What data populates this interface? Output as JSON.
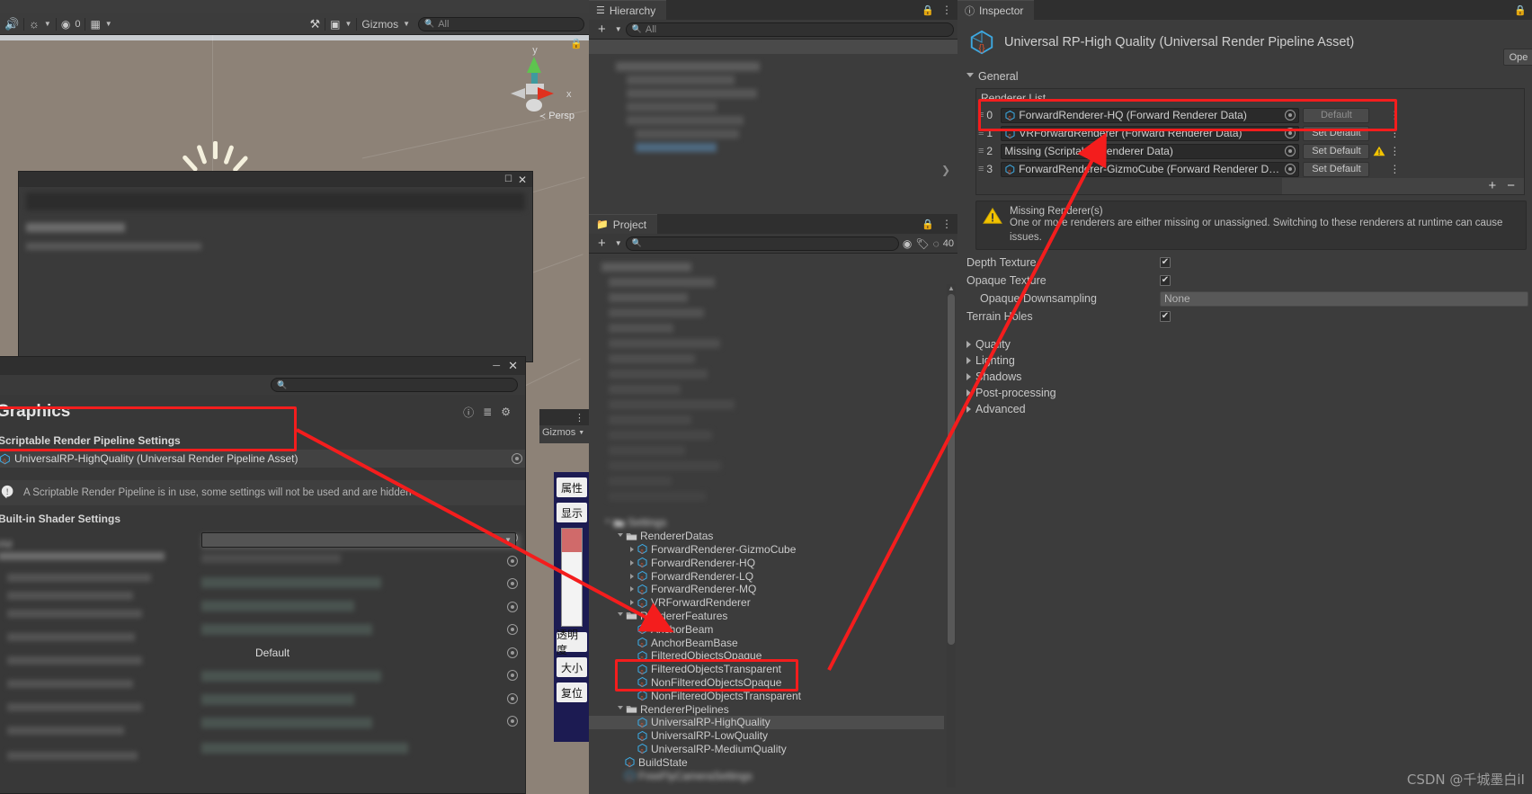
{
  "scene": {
    "toolbar": {
      "audio_icon": "audio-mute-icon",
      "lighting_icon": "lighting-icon",
      "fx_count": "0",
      "grid_icon": "grid-snap-icon",
      "tools_icon": "scene-tools-icon",
      "camera_icon": "scene-camera-icon",
      "gizmos_label": "Gizmos",
      "search_placeholder": "All"
    },
    "gizmo": {
      "axis_y": "y",
      "axis_x": "x",
      "persp_label": "Persp"
    }
  },
  "hierarchy": {
    "tab_label": "Hierarchy",
    "add_label": "+",
    "search_placeholder": "All",
    "lock_icon": "lock-icon",
    "menu_icon": "kebab-menu-icon"
  },
  "project": {
    "tab_label": "Project",
    "add_label": "+",
    "search_placeholder": "",
    "badge_count": "40",
    "lock_icon": "lock-icon",
    "menu_icon": "kebab-menu-icon",
    "tree": [
      {
        "label": "Settings",
        "indent": 1,
        "type": "folder",
        "state": "open",
        "blur": true
      },
      {
        "label": "RendererDatas",
        "indent": 2,
        "type": "folder",
        "state": "open"
      },
      {
        "label": "ForwardRenderer-GizmoCube",
        "indent": 3,
        "type": "asset",
        "state": "closed"
      },
      {
        "label": "ForwardRenderer-HQ",
        "indent": 3,
        "type": "asset",
        "state": "closed"
      },
      {
        "label": "ForwardRenderer-LQ",
        "indent": 3,
        "type": "asset",
        "state": "closed"
      },
      {
        "label": "ForwardRenderer-MQ",
        "indent": 3,
        "type": "asset",
        "state": "closed"
      },
      {
        "label": "VRForwardRenderer",
        "indent": 3,
        "type": "asset",
        "state": "closed"
      },
      {
        "label": "RendererFeatures",
        "indent": 2,
        "type": "folder",
        "state": "open"
      },
      {
        "label": "AnchorBeam",
        "indent": 3,
        "type": "asset",
        "state": "none"
      },
      {
        "label": "AnchorBeamBase",
        "indent": 3,
        "type": "asset",
        "state": "none"
      },
      {
        "label": "FilteredObjectsOpaque",
        "indent": 3,
        "type": "asset",
        "state": "none"
      },
      {
        "label": "FilteredObjectsTransparent",
        "indent": 3,
        "type": "asset",
        "state": "none"
      },
      {
        "label": "NonFilteredObjectsOpaque",
        "indent": 3,
        "type": "asset",
        "state": "none"
      },
      {
        "label": "NonFilteredObjectsTransparent",
        "indent": 3,
        "type": "asset",
        "state": "none"
      },
      {
        "label": "RendererPipelines",
        "indent": 2,
        "type": "folder",
        "state": "open"
      },
      {
        "label": "UniversalRP-HighQuality",
        "indent": 3,
        "type": "asset",
        "state": "none",
        "selected": true
      },
      {
        "label": "UniversalRP-LowQuality",
        "indent": 3,
        "type": "asset",
        "state": "none"
      },
      {
        "label": "UniversalRP-MediumQuality",
        "indent": 3,
        "type": "asset",
        "state": "none"
      },
      {
        "label": "BuildState",
        "indent": 2,
        "type": "asset",
        "state": "none"
      },
      {
        "label": "FreeFlyCameraSettings",
        "indent": 2,
        "type": "asset",
        "state": "none",
        "blur": true
      }
    ]
  },
  "inspector": {
    "tab_label": "Inspector",
    "info_icon": "info-icon",
    "lock_icon": "lock-icon",
    "menu_icon": "kebab-menu-icon",
    "asset_title": "Universal RP-High Quality (Universal Render Pipeline Asset)",
    "open_button": "Ope",
    "sections": {
      "general": "General",
      "quality": "Quality",
      "lighting": "Lighting",
      "shadows": "Shadows",
      "post_processing": "Post-processing",
      "advanced": "Advanced"
    },
    "renderer_list": {
      "label": "Renderer List",
      "add_label": "+",
      "remove_label": "−",
      "rows": [
        {
          "index": "0",
          "value": "ForwardRenderer-HQ (Forward Renderer Data)",
          "button": "Default",
          "default": true,
          "warning": false
        },
        {
          "index": "1",
          "value": "VRForwardRenderer (Forward Renderer Data)",
          "button": "Set Default",
          "default": false,
          "warning": false
        },
        {
          "index": "2",
          "value": "Missing (Scriptable Renderer Data)",
          "button": "Set Default",
          "default": false,
          "warning": true,
          "missing": true
        },
        {
          "index": "3",
          "value": "ForwardRenderer-GizmoCube (Forward Renderer Data)",
          "button": "Set Default",
          "default": false,
          "warning": false
        }
      ]
    },
    "warning": {
      "icon": "warning-triangle-icon",
      "title": "Missing Renderer(s)",
      "body": "One or more renderers are either missing or unassigned.  Switching to these renderers at runtime can cause issues."
    },
    "properties": [
      {
        "label": "Depth Texture",
        "type": "checkbox",
        "value": true,
        "indent": 0
      },
      {
        "label": "Opaque Texture",
        "type": "checkbox",
        "value": true,
        "indent": 0
      },
      {
        "label": "Opaque Downsampling",
        "type": "dropdown",
        "value": "None",
        "indent": 1
      },
      {
        "label": "Terrain Holes",
        "type": "checkbox",
        "value": true,
        "indent": 0
      }
    ]
  },
  "graphics_window": {
    "title": "Graphics",
    "search_placeholder": "",
    "help_icon": "help-icon",
    "preset_icon": "preset-icon",
    "gear_icon": "gear-icon",
    "srp_header": "Scriptable Render Pipeline Settings",
    "srp_value": "UniversalRP-HighQuality (Universal Render Pipeline Asset)",
    "info_icon": "info-icon",
    "info_text": "A Scriptable Render Pipeline is in use, some settings will not be used and are hidden",
    "builtin_header": "Built-in Shader Settings",
    "video_label": "Vid",
    "default_value": "Default"
  },
  "chinese_toolbar": {
    "buttons": [
      "属性",
      "显示",
      "透明度",
      "大小",
      "复位"
    ]
  },
  "watermark": "CSDN @千城墨白iI",
  "colors": {
    "accent_red": "#f41d1d",
    "panel_bg": "#383838",
    "tab_bg": "#3c3c3c",
    "asset_blue": "#3da8e0",
    "warning_yellow": "#f2c300"
  }
}
